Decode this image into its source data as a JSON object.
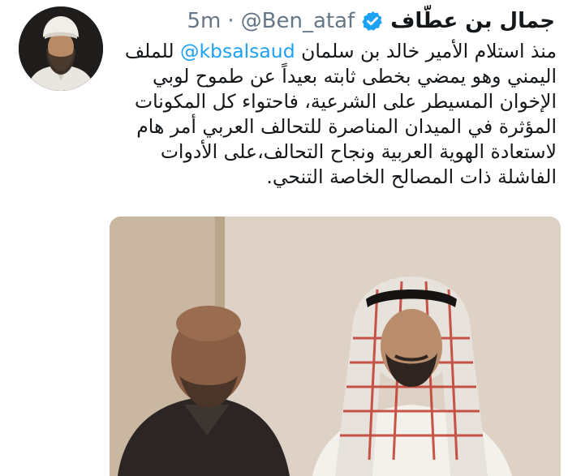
{
  "author": {
    "display_name": "جمال بن عطّاف",
    "handle": "@Ben_ataf",
    "separator": "·",
    "time": "5m",
    "verified_icon": "verified-badge-icon",
    "verified_color": "#1da1f2"
  },
  "tweet": {
    "line1_before": "منذ استلام الأمير خالد بن سلمان ",
    "mention": "@kbsalsaud",
    "line1_after": " للملف",
    "line2": "اليمني وهو يمضي بخطى ثابته بعيداً عن طموح لوبي",
    "line3": "الإخوان المسيطر على الشرعية، فاحتواء كل المكونات",
    "line4": "المؤثرة في الميدان المناصرة للتحالف العربي أمر هام",
    "line5": "لاستعادة الهوية العربية ونجاح التحالف،على الأدوات",
    "line6": "الفاشلة ذات المصالح الخاصة التنحي."
  },
  "colors": {
    "text": "#14171a",
    "muted": "#657786",
    "link": "#1da1f2"
  }
}
